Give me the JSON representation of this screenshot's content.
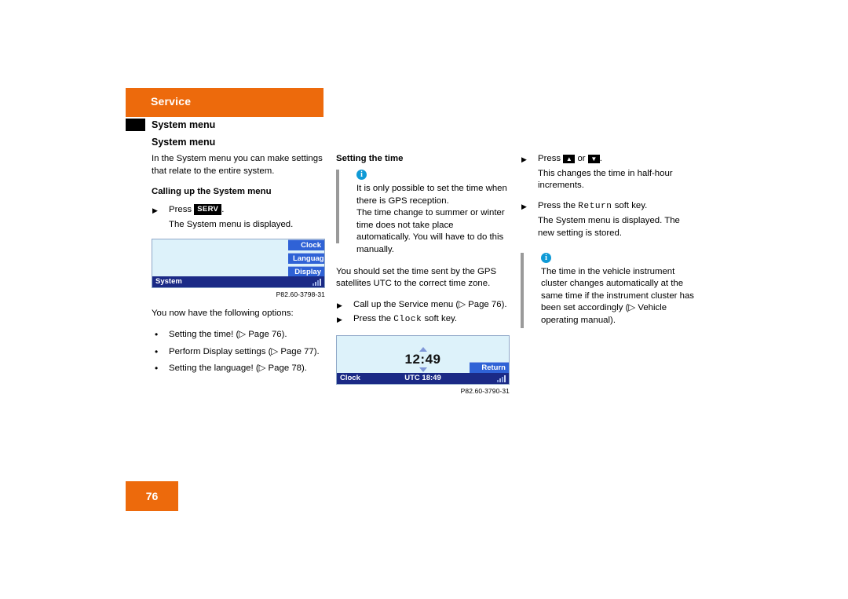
{
  "header": {
    "section_label": "Service",
    "subtitle_1": "System menu",
    "subtitle_2": "System menu"
  },
  "left_column": {
    "intro": "In the System menu you can make settings that relate to the entire system.",
    "heading": "Calling up the System menu",
    "step_press_prefix": "Press",
    "step_press_key": "SERV",
    "step_press_suffix": ".",
    "step_result": "The System menu is displayed.",
    "screenshot": {
      "softkeys": [
        "Clock",
        "Languag.",
        "Display"
      ],
      "status_left": "System",
      "caption": "P82.60-3798-31"
    },
    "options_lead": "You now have the following options:",
    "options": [
      "Setting the time! (▷ Page 76).",
      "Perform Display settings (▷ Page 77).",
      "Setting the language! (▷ Page 78)."
    ]
  },
  "middle_column": {
    "heading": "Setting the time",
    "note": "It is only possible to set the time when there is GPS reception.\nThe time change to summer or winter time does not take place automatically. You will have to do this manually.",
    "paragraph": "You should set the time sent by the GPS satellites UTC to the correct time zone.",
    "step_1": "Call up the Service menu (▷ Page 76).",
    "step_2_prefix": "Press the",
    "step_2_key": "Clock",
    "step_2_suffix": "soft key.",
    "screenshot": {
      "time": "12:49",
      "softkey_return": "Return",
      "status_left": "Clock",
      "status_mid": "UTC 18:49",
      "caption": "P82.60-3790-31"
    }
  },
  "right_column": {
    "step_1_prefix": "Press",
    "step_1_key_up": "▲",
    "step_1_or": "or",
    "step_1_key_down": "▼",
    "step_1_suffix": ".",
    "step_1_result": "This changes the time in half-hour increments.",
    "step_2_prefix": "Press the",
    "step_2_key": "Return",
    "step_2_suffix": "soft key.",
    "step_2_result": "The System menu is displayed. The new setting is stored.",
    "note": "The time in the vehicle instrument cluster changes automatically at the same time if the instrument cluster has been set accordingly (▷ Vehicle operating manual)."
  },
  "footer": {
    "page_number": "76"
  },
  "colors": {
    "accent_orange": "#ed6a0c",
    "display_bg": "#ddf2fa",
    "display_statusbar": "#1b2a86",
    "softkey_blue": "#2f62d6",
    "note_rule": "#9a9a9a",
    "info_icon": "#0f9ad6"
  }
}
